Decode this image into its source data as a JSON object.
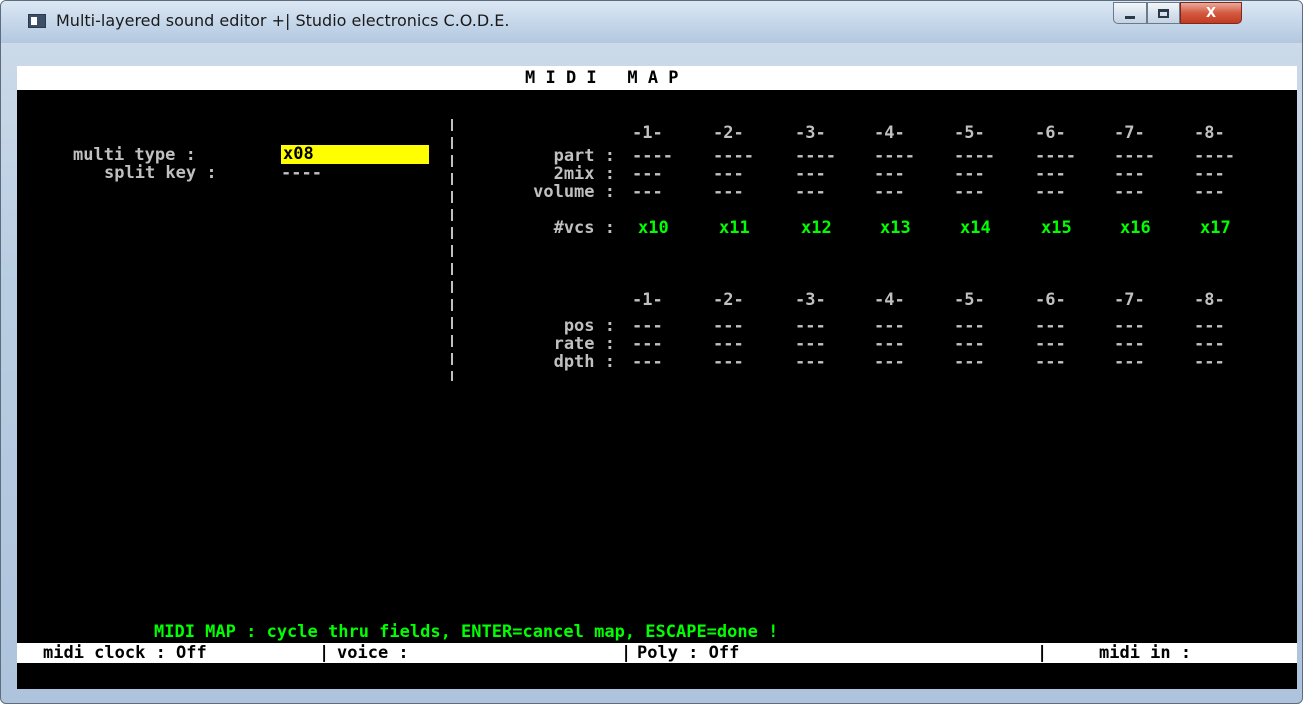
{
  "window": {
    "title": "Multi-layered sound editor +| Studio electronics C.O.D.E.",
    "close_glyph": "X"
  },
  "header": {
    "title": "M I D I   M A P"
  },
  "left": {
    "multi_type_label": "multi type :",
    "multi_type_value": "x08",
    "split_key_label": "split key :",
    "split_key_value": "----"
  },
  "table1": {
    "columns": [
      "-1-",
      "-2-",
      "-3-",
      "-4-",
      "-5-",
      "-6-",
      "-7-",
      "-8-"
    ],
    "rows": [
      {
        "label": "part :",
        "values": [
          "----",
          "----",
          "----",
          "----",
          "----",
          "----",
          "----",
          "----"
        ]
      },
      {
        "label": "2mix :",
        "values": [
          "---",
          "---",
          "---",
          "---",
          "---",
          "---",
          "---",
          "---"
        ]
      },
      {
        "label": "volume :",
        "values": [
          "---",
          "---",
          "---",
          "---",
          "---",
          "---",
          "---",
          "---"
        ]
      },
      {
        "label": "#vcs :",
        "values": [
          "x10",
          "x11",
          "x12",
          "x13",
          "x14",
          "x15",
          "x16",
          "x17"
        ]
      }
    ]
  },
  "table2": {
    "columns": [
      "-1-",
      "-2-",
      "-3-",
      "-4-",
      "-5-",
      "-6-",
      "-7-",
      "-8-"
    ],
    "rows": [
      {
        "label": "pos :",
        "values": [
          "---",
          "---",
          "---",
          "---",
          "---",
          "---",
          "---",
          "---"
        ]
      },
      {
        "label": "rate :",
        "values": [
          "---",
          "---",
          "---",
          "---",
          "---",
          "---",
          "---",
          "---"
        ]
      },
      {
        "label": "dpth :",
        "values": [
          "---",
          "---",
          "---",
          "---",
          "---",
          "---",
          "---",
          "---"
        ]
      }
    ]
  },
  "status": {
    "help": "MIDI MAP : cycle thru fields, ENTER=cancel map, ESCAPE=done !",
    "midi_clock": "midi clock : Off",
    "sep1": "|",
    "voice": "voice :",
    "sep2": "|",
    "poly": "Poly : Off",
    "sep3": "|",
    "midi_in": "midi in :"
  },
  "colors": {
    "console_bg": "#000000",
    "text_normal": "#c0c0c0",
    "text_highlight": "#00ff00",
    "field_active_bg": "#ffff00",
    "bar_bg": "#ffffff"
  }
}
